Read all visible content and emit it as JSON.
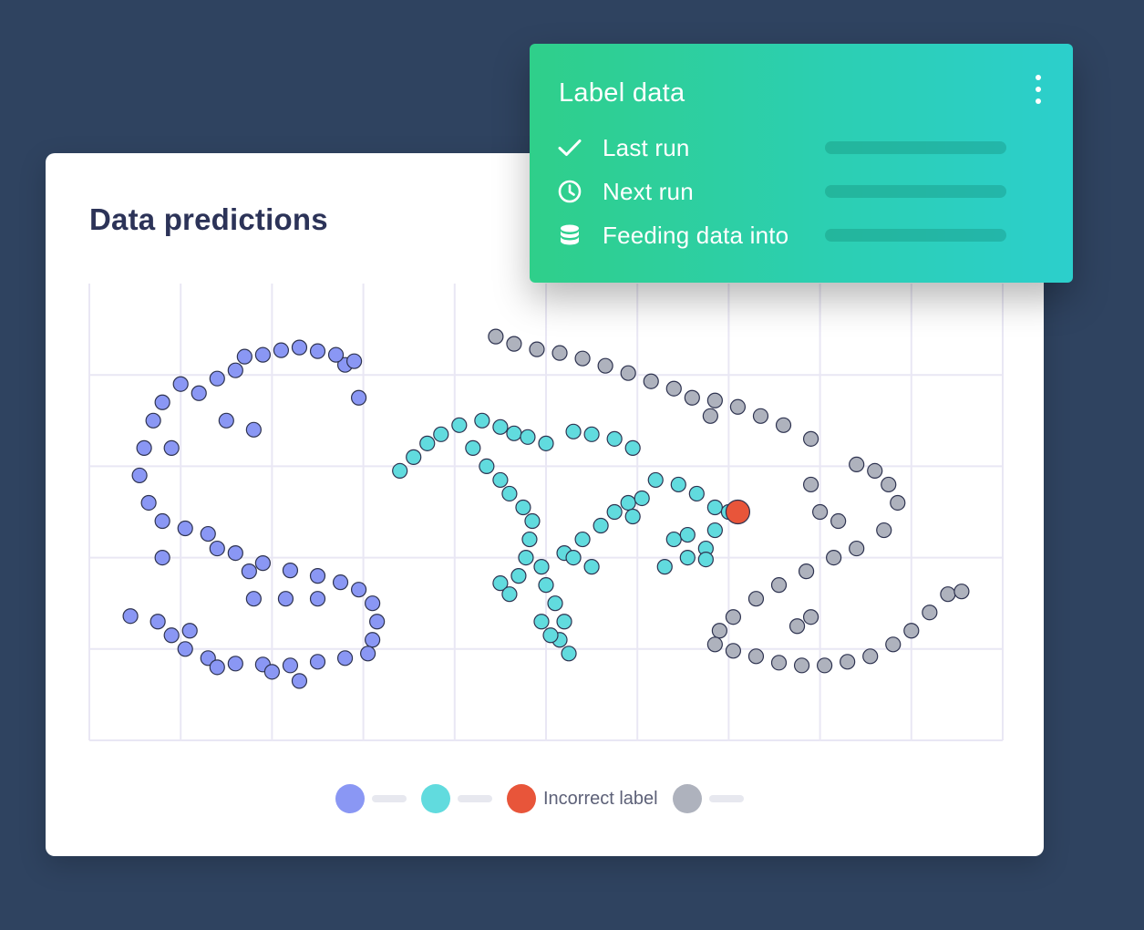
{
  "card": {
    "title": "Data predictions"
  },
  "chart_data": {
    "type": "scatter",
    "title": "Data predictions",
    "xlabel": "",
    "ylabel": "",
    "grid": true,
    "legend_placement": "bottom-center",
    "series": [
      {
        "color": "#8a97f4",
        "points": [
          [
            1.4,
            3.96
          ],
          [
            1.6,
            4.05
          ],
          [
            1.9,
            4.22
          ],
          [
            2.1,
            4.27
          ],
          [
            2.5,
            4.26
          ],
          [
            2.8,
            4.11
          ],
          [
            2.95,
            3.75
          ],
          [
            2.9,
            4.15
          ],
          [
            2.7,
            4.22
          ],
          [
            2.3,
            4.3
          ],
          [
            1.7,
            4.2
          ],
          [
            1.2,
            3.8
          ],
          [
            1.5,
            3.5
          ],
          [
            1.8,
            3.4
          ],
          [
            0.8,
            3.7
          ],
          [
            0.7,
            3.5
          ],
          [
            0.6,
            3.2
          ],
          [
            0.55,
            2.9
          ],
          [
            0.65,
            2.6
          ],
          [
            0.8,
            2.4
          ],
          [
            1.05,
            2.32
          ],
          [
            1.3,
            2.26
          ],
          [
            1.6,
            2.05
          ],
          [
            1.9,
            1.94
          ],
          [
            2.2,
            1.86
          ],
          [
            2.5,
            1.8
          ],
          [
            2.75,
            1.73
          ],
          [
            2.95,
            1.65
          ],
          [
            3.1,
            1.5
          ],
          [
            3.15,
            1.3
          ],
          [
            3.1,
            1.1
          ],
          [
            3.05,
            0.95
          ],
          [
            2.8,
            0.9
          ],
          [
            2.5,
            0.86
          ],
          [
            2.2,
            0.82
          ],
          [
            1.9,
            0.83
          ],
          [
            1.6,
            0.84
          ],
          [
            1.3,
            0.9
          ],
          [
            1.05,
            1.0
          ],
          [
            0.9,
            1.15
          ],
          [
            0.75,
            1.3
          ],
          [
            0.45,
            1.36
          ],
          [
            1.0,
            3.9
          ],
          [
            0.9,
            3.2
          ],
          [
            0.8,
            2.0
          ],
          [
            1.4,
            2.1
          ],
          [
            1.75,
            1.85
          ],
          [
            2.15,
            1.55
          ],
          [
            2.5,
            1.55
          ],
          [
            1.8,
            1.55
          ],
          [
            1.1,
            1.2
          ],
          [
            1.4,
            0.8
          ],
          [
            2.0,
            0.75
          ],
          [
            2.3,
            0.65
          ]
        ]
      },
      {
        "color": "#61dbde",
        "points": [
          [
            3.4,
            2.95
          ],
          [
            3.55,
            3.1
          ],
          [
            3.7,
            3.25
          ],
          [
            3.85,
            3.35
          ],
          [
            4.05,
            3.45
          ],
          [
            4.3,
            3.5
          ],
          [
            4.5,
            3.43
          ],
          [
            4.65,
            3.36
          ],
          [
            4.8,
            3.32
          ],
          [
            5.0,
            3.25
          ],
          [
            4.2,
            3.2
          ],
          [
            4.35,
            3.0
          ],
          [
            4.5,
            2.85
          ],
          [
            4.6,
            2.7
          ],
          [
            4.75,
            2.55
          ],
          [
            4.85,
            2.4
          ],
          [
            4.82,
            2.2
          ],
          [
            4.78,
            2.0
          ],
          [
            4.7,
            1.8
          ],
          [
            4.5,
            1.72
          ],
          [
            4.6,
            1.6
          ],
          [
            4.95,
            1.9
          ],
          [
            5.0,
            1.7
          ],
          [
            5.1,
            1.5
          ],
          [
            5.2,
            1.3
          ],
          [
            5.15,
            1.1
          ],
          [
            5.25,
            0.95
          ],
          [
            4.95,
            1.3
          ],
          [
            5.05,
            1.15
          ],
          [
            5.2,
            2.05
          ],
          [
            5.4,
            2.2
          ],
          [
            5.6,
            2.35
          ],
          [
            5.75,
            2.5
          ],
          [
            5.9,
            2.6
          ],
          [
            6.05,
            2.65
          ],
          [
            5.95,
            2.45
          ],
          [
            5.5,
            1.9
          ],
          [
            5.3,
            2.0
          ],
          [
            5.3,
            3.38
          ],
          [
            5.5,
            3.35
          ],
          [
            5.75,
            3.3
          ],
          [
            5.95,
            3.2
          ],
          [
            6.2,
            2.85
          ],
          [
            6.45,
            2.8
          ],
          [
            6.65,
            2.7
          ],
          [
            6.85,
            2.55
          ],
          [
            7.0,
            2.5
          ],
          [
            6.85,
            2.3
          ],
          [
            6.75,
            2.1
          ],
          [
            6.55,
            2.0
          ],
          [
            6.4,
            2.2
          ],
          [
            6.55,
            2.25
          ],
          [
            6.75,
            1.98
          ],
          [
            6.3,
            1.9
          ]
        ]
      },
      {
        "name": "Incorrect label",
        "color": "#e8553a",
        "points": [
          [
            7.1,
            2.5
          ]
        ]
      },
      {
        "color": "#aeb2bd",
        "points": [
          [
            4.45,
            4.42
          ],
          [
            4.65,
            4.34
          ],
          [
            4.9,
            4.28
          ],
          [
            5.15,
            4.24
          ],
          [
            5.4,
            4.18
          ],
          [
            5.65,
            4.1
          ],
          [
            5.9,
            4.02
          ],
          [
            6.15,
            3.93
          ],
          [
            6.4,
            3.85
          ],
          [
            6.6,
            3.75
          ],
          [
            6.85,
            3.72
          ],
          [
            7.1,
            3.65
          ],
          [
            7.35,
            3.55
          ],
          [
            7.6,
            3.45
          ],
          [
            7.9,
            3.3
          ],
          [
            6.8,
            3.55
          ],
          [
            8.4,
            3.02
          ],
          [
            8.6,
            2.95
          ],
          [
            8.75,
            2.8
          ],
          [
            8.85,
            2.6
          ],
          [
            8.7,
            2.3
          ],
          [
            8.4,
            2.1
          ],
          [
            8.15,
            2.0
          ],
          [
            7.85,
            1.85
          ],
          [
            7.55,
            1.7
          ],
          [
            7.3,
            1.55
          ],
          [
            7.05,
            1.35
          ],
          [
            6.9,
            1.2
          ],
          [
            6.85,
            1.05
          ],
          [
            7.05,
            0.98
          ],
          [
            7.3,
            0.92
          ],
          [
            7.55,
            0.85
          ],
          [
            7.8,
            0.82
          ],
          [
            8.05,
            0.82
          ],
          [
            8.3,
            0.86
          ],
          [
            8.55,
            0.92
          ],
          [
            8.8,
            1.05
          ],
          [
            9.0,
            1.2
          ],
          [
            9.2,
            1.4
          ],
          [
            9.4,
            1.6
          ],
          [
            9.55,
            1.63
          ],
          [
            8.0,
            2.5
          ],
          [
            8.2,
            2.4
          ],
          [
            7.9,
            1.35
          ],
          [
            7.75,
            1.25
          ],
          [
            7.9,
            2.8
          ]
        ]
      }
    ],
    "legend": [
      {
        "series": 0,
        "label": ""
      },
      {
        "series": 1,
        "label": ""
      },
      {
        "series": 2,
        "label": "Incorrect label"
      },
      {
        "series": 3,
        "label": ""
      }
    ]
  },
  "legend": {
    "items": [
      {
        "color": "#8a97f4",
        "label": ""
      },
      {
        "color": "#61dbde",
        "label": ""
      },
      {
        "color": "#e8553a",
        "label": "Incorrect label"
      },
      {
        "color": "#aeb2bd",
        "label": ""
      }
    ]
  },
  "panel": {
    "title": "Label data",
    "menu_icon": "more-vertical-icon",
    "rows": [
      {
        "icon": "check-icon",
        "label": "Last run"
      },
      {
        "icon": "clock-icon",
        "label": "Next run"
      },
      {
        "icon": "database-icon",
        "label": "Feeding data into"
      }
    ],
    "gradient": [
      "#2fcf8a",
      "#2ccfcc"
    ]
  },
  "colors": {
    "title": "#2c3358",
    "grid": "#e9e7f4",
    "marker_stroke": "#2e3350"
  }
}
